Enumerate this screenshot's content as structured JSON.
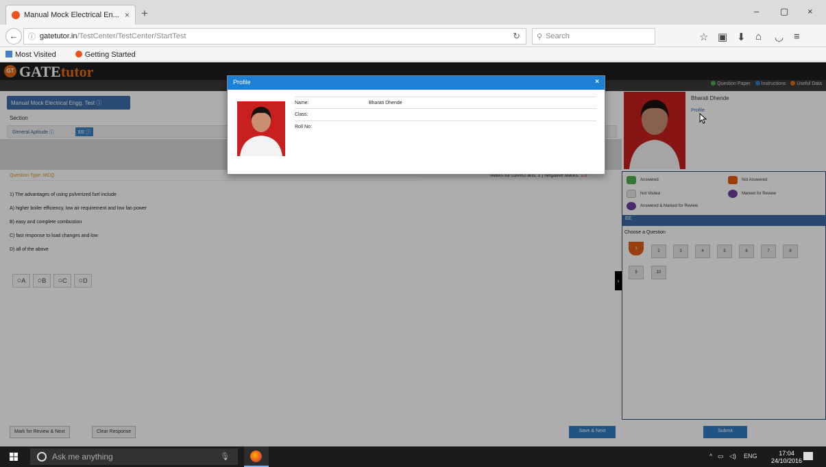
{
  "browser": {
    "tab_title": "Manual Mock Electrical En...",
    "tab_close": "×",
    "new_tab": "+",
    "window_controls": [
      "–",
      "▢",
      "×"
    ],
    "url_host": "gatetutor.in",
    "url_path": "/TestCenter/TestCenter/StartTest",
    "search_placeholder": "Search",
    "bookmarks": [
      "Most Visited",
      "Getting Started"
    ]
  },
  "site": {
    "logo_prefix": "GATE",
    "logo_suffix": "tutor",
    "logo_badge": "GT",
    "top_links": [
      "Question Paper",
      "Instructions",
      "Useful Data"
    ]
  },
  "test": {
    "title": "Manual Mock Electrical Engg. Test",
    "section_label": "Section",
    "sections": [
      "General Aptitude",
      "EE"
    ],
    "question_type": "Question Type: MCQ",
    "marks": "Marks for correct ans: 1 | Negative Marks:",
    "negative_marks": "1/3",
    "question": "1) The advantages of using pulverized fuel include",
    "options_text": [
      "A) higher boiler efficiency, low air requirement and low fan power",
      "B) easy and complete combustion",
      "C) fast response to load changes and low",
      "D) all of the above"
    ],
    "option_labels": [
      "A",
      "B",
      "C",
      "D"
    ],
    "buttons": {
      "mark_review": "Mark for Review & Next",
      "clear": "Clear Response",
      "save_next": "Save & Next",
      "submit": "Submit"
    }
  },
  "candidate": {
    "name": "Bharati Dhende",
    "profile_link": "Profile"
  },
  "legend": {
    "answered": "Answered",
    "not_answered": "Not Answered",
    "not_visited": "Not Visited",
    "marked": "Marked for Review",
    "answered_marked": "Answered & Marked for Review",
    "section": "EE",
    "choose": "Choose a Question",
    "questions": [
      "1",
      "2",
      "3",
      "4",
      "5",
      "6",
      "7",
      "8",
      "9",
      "10"
    ]
  },
  "modal": {
    "title": "Profile",
    "close": "×",
    "rows": [
      {
        "label": "Name:",
        "value": "Bharati Dhende"
      },
      {
        "label": "Class:",
        "value": ""
      },
      {
        "label": "Roll No:",
        "value": ""
      }
    ]
  },
  "taskbar": {
    "search_placeholder": "Ask me anything",
    "lang": "ENG",
    "time": "17:04",
    "date": "24/10/2016"
  },
  "colors": {
    "modal_header": "#1e7fd6",
    "accent_orange": "#e86a12",
    "button_blue": "#2f7cc2"
  }
}
